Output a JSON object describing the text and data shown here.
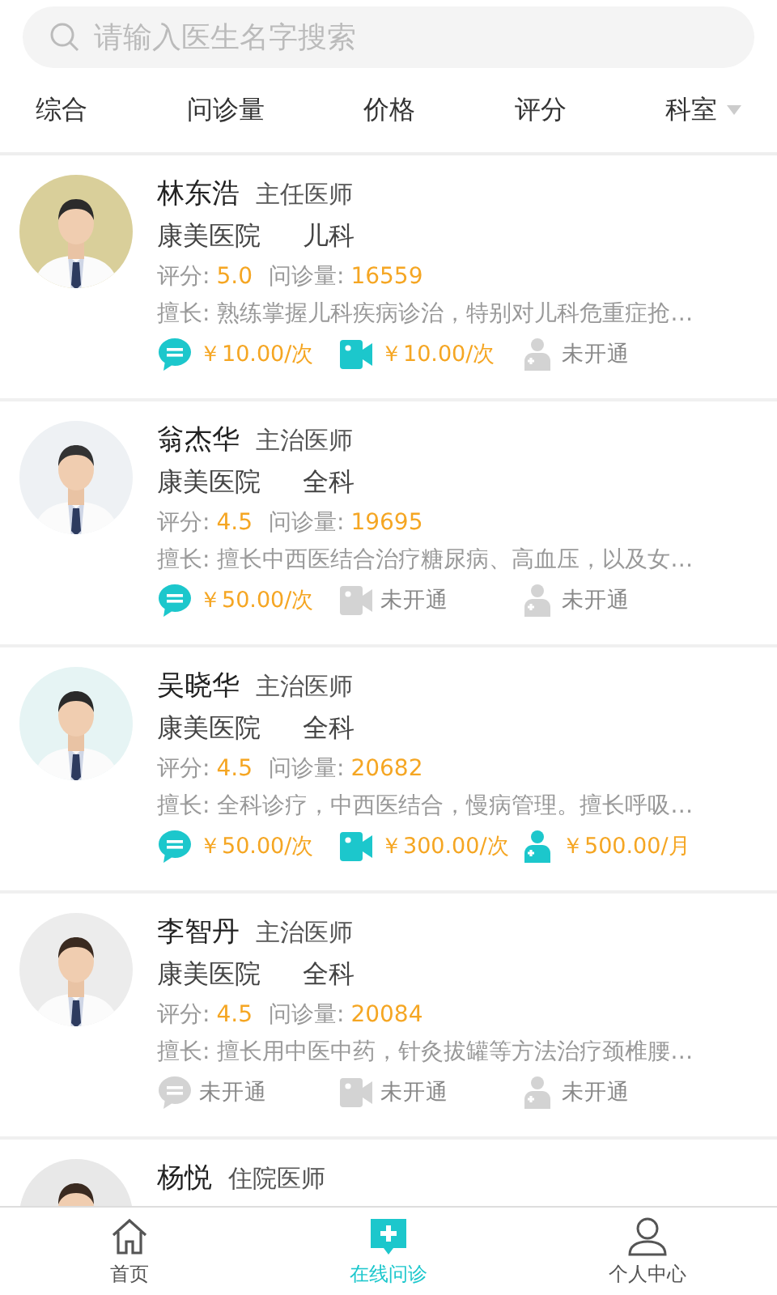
{
  "search": {
    "placeholder": "请输入医生名字搜索"
  },
  "filters": [
    {
      "label": "综合",
      "dropdown": false
    },
    {
      "label": "问诊量",
      "dropdown": false
    },
    {
      "label": "价格",
      "dropdown": false
    },
    {
      "label": "评分",
      "dropdown": false
    },
    {
      "label": "科室",
      "dropdown": true
    }
  ],
  "doctors": [
    {
      "name": "林东浩",
      "title": "主任医师",
      "hospital": "康美医院",
      "department": "儿科",
      "rating_label": "评分:",
      "rating": "5.0",
      "count_label": "问诊量:",
      "count": "16559",
      "specialty": "擅长: 熟练掌握儿科疾病诊治，特别对儿科危重症抢…",
      "services": [
        {
          "kind": "text",
          "enabled": true,
          "label": "￥10.00/次"
        },
        {
          "kind": "video",
          "enabled": true,
          "label": "￥10.00/次"
        },
        {
          "kind": "private",
          "enabled": false,
          "label": "未开通"
        }
      ]
    },
    {
      "name": "翁杰华",
      "title": "主治医师",
      "hospital": "康美医院",
      "department": "全科",
      "rating_label": "评分:",
      "rating": "4.5",
      "count_label": "问诊量:",
      "count": "19695",
      "specialty": "擅长: 擅长中西医结合治疗糖尿病、高血压，以及女…",
      "services": [
        {
          "kind": "text",
          "enabled": true,
          "label": "￥50.00/次"
        },
        {
          "kind": "video",
          "enabled": false,
          "label": "未开通"
        },
        {
          "kind": "private",
          "enabled": false,
          "label": "未开通"
        }
      ]
    },
    {
      "name": "吴晓华",
      "title": "主治医师",
      "hospital": "康美医院",
      "department": "全科",
      "rating_label": "评分:",
      "rating": "4.5",
      "count_label": "问诊量:",
      "count": "20682",
      "specialty": "擅长: 全科诊疗，中西医结合，慢病管理。擅长呼吸…",
      "services": [
        {
          "kind": "text",
          "enabled": true,
          "label": "￥50.00/次"
        },
        {
          "kind": "video",
          "enabled": true,
          "label": "￥300.00/次"
        },
        {
          "kind": "private",
          "enabled": true,
          "label": "￥500.00/月"
        }
      ]
    },
    {
      "name": "李智丹",
      "title": "主治医师",
      "hospital": "康美医院",
      "department": "全科",
      "rating_label": "评分:",
      "rating": "4.5",
      "count_label": "问诊量:",
      "count": "20084",
      "specialty": "擅长: 擅长用中医中药，针灸拔罐等方法治疗颈椎腰…",
      "services": [
        {
          "kind": "text",
          "enabled": false,
          "label": "未开通"
        },
        {
          "kind": "video",
          "enabled": false,
          "label": "未开通"
        },
        {
          "kind": "private",
          "enabled": false,
          "label": "未开通"
        }
      ]
    },
    {
      "name": "杨悦",
      "title": "住院医师"
    }
  ],
  "tabbar": [
    {
      "kind": "home",
      "label": "首页",
      "selected": false
    },
    {
      "kind": "consult",
      "label": "在线问诊",
      "selected": true
    },
    {
      "kind": "profile",
      "label": "个人中心",
      "selected": false
    }
  ]
}
